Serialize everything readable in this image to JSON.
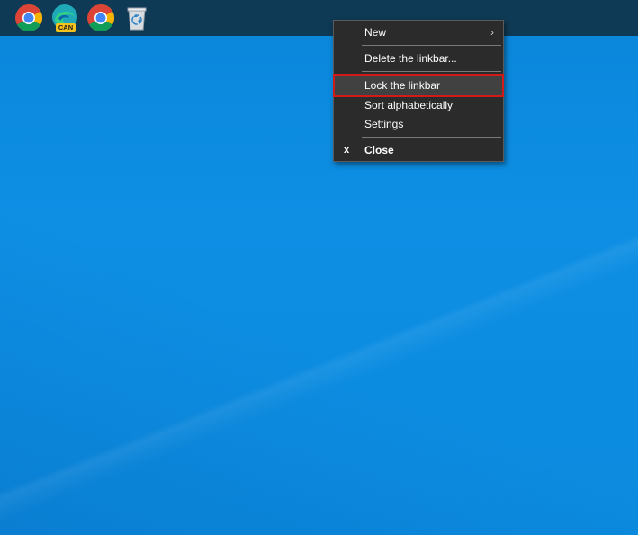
{
  "linkbar": {
    "icons": [
      {
        "name": "chrome-icon"
      },
      {
        "name": "edge-canary-icon",
        "badge": "CAN"
      },
      {
        "name": "chrome-icon"
      },
      {
        "name": "recycle-bin-icon"
      }
    ]
  },
  "context_menu": {
    "items": [
      {
        "label": "New"
      },
      {
        "label": "Delete the linkbar..."
      },
      {
        "label": "Lock the linkbar"
      },
      {
        "label": "Sort alphabetically"
      },
      {
        "label": "Settings"
      },
      {
        "label": "Close",
        "glyph": "x"
      }
    ],
    "highlight_color": "#d11a1a"
  },
  "colors": {
    "linkbar_bg": "#0f3a55",
    "desktop_bg": "#0b8ade",
    "menu_bg": "#2b2b2b"
  }
}
